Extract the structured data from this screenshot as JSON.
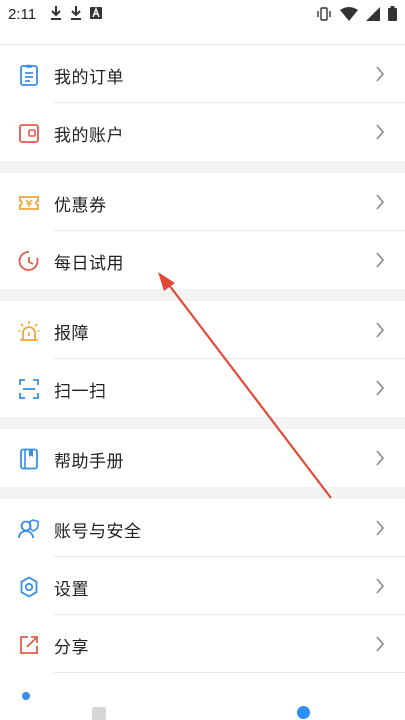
{
  "status_bar": {
    "time": "2:11",
    "left_icons": [
      "download-icon",
      "download-icon",
      "a-badge-icon"
    ],
    "right_icons": [
      "vibrate-icon",
      "wifi-icon",
      "signal-icon",
      "battery-icon"
    ]
  },
  "menu": {
    "groups": [
      {
        "items": [
          {
            "label": "我的订单",
            "icon": "order-icon",
            "color": "#3a8ee6"
          },
          {
            "label": "我的账户",
            "icon": "wallet-icon",
            "color": "#e25c4b"
          }
        ]
      },
      {
        "items": [
          {
            "label": "优惠券",
            "icon": "coupon-icon",
            "color": "#f0a63a"
          },
          {
            "label": "每日试用",
            "icon": "clock-icon",
            "color": "#e25c4b"
          }
        ]
      },
      {
        "items": [
          {
            "label": "报障",
            "icon": "alarm-icon",
            "color": "#f0a63a"
          },
          {
            "label": "扫一扫",
            "icon": "scan-icon",
            "color": "#3a8ee6"
          }
        ]
      },
      {
        "items": [
          {
            "label": "帮助手册",
            "icon": "book-icon",
            "color": "#3a8ee6"
          }
        ]
      },
      {
        "items": [
          {
            "label": "账号与安全",
            "icon": "account-security-icon",
            "color": "#3a8ee6"
          },
          {
            "label": "设置",
            "icon": "settings-gear-icon",
            "color": "#3a8ee6"
          },
          {
            "label": "分享",
            "icon": "share-icon",
            "color": "#e25c4b"
          }
        ]
      }
    ]
  },
  "colors": {
    "blue": "#3a8ee6",
    "red": "#e25c4b",
    "orange": "#f0a63a",
    "annotation_arrow": "#e04a36",
    "nav_active": "#2c8ef8"
  }
}
